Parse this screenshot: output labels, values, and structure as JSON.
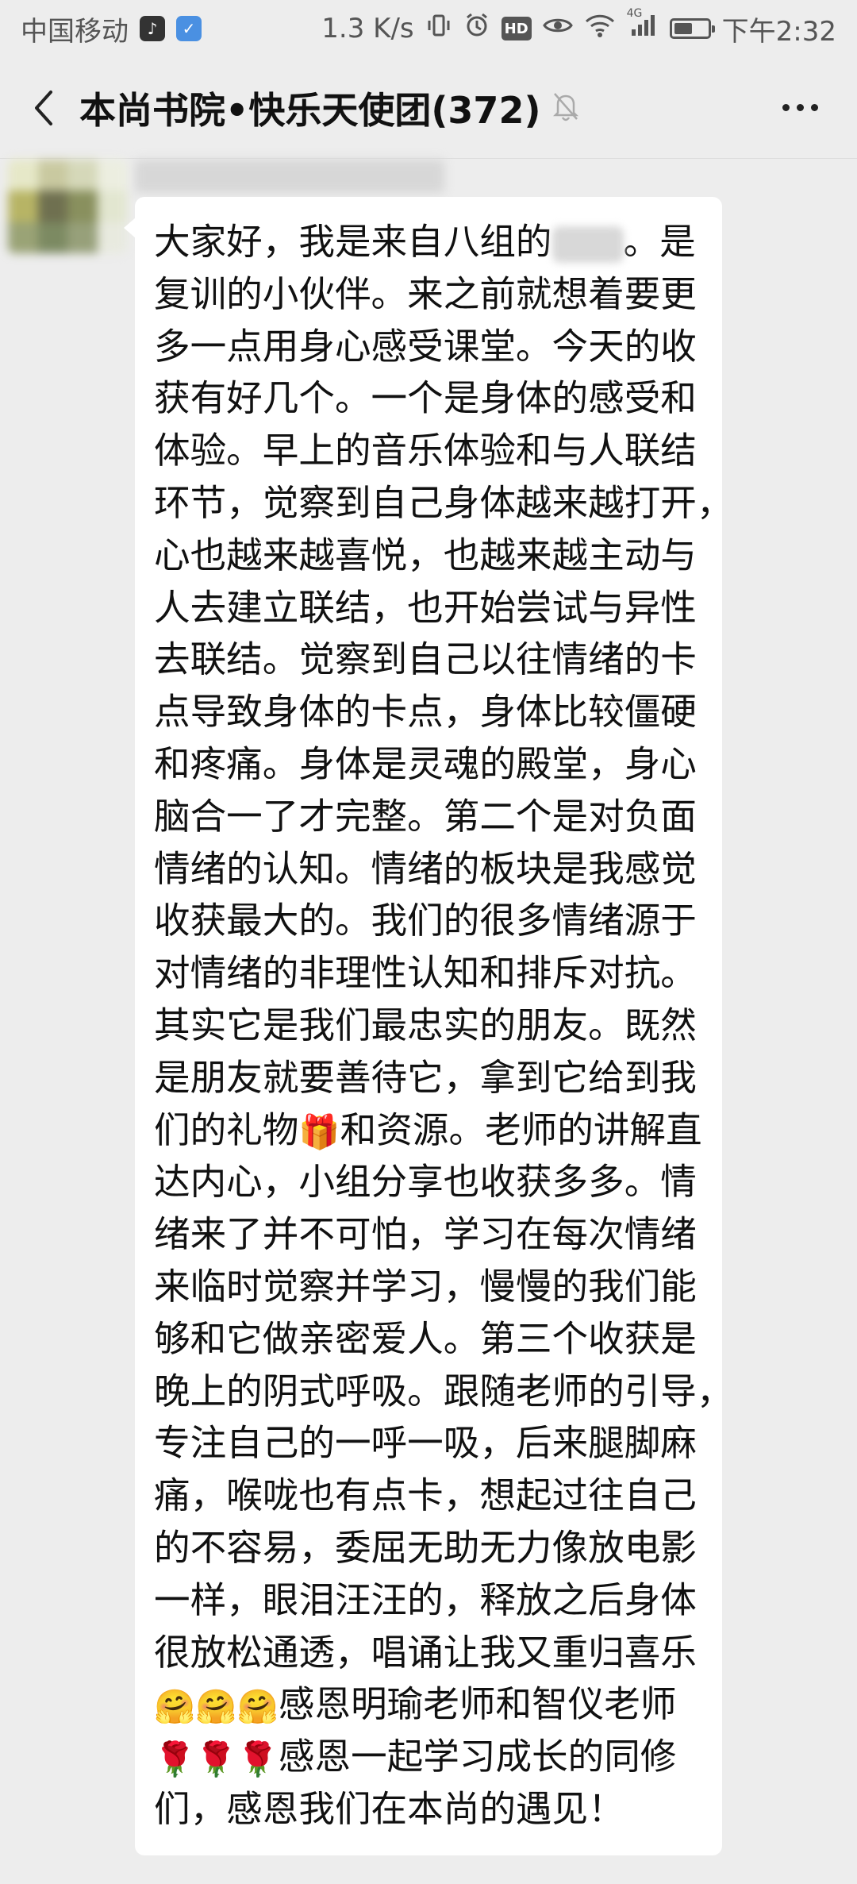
{
  "status_bar": {
    "carrier": "中国移动",
    "speed": "1.3 K/s",
    "network": "4G",
    "battery_level": 0.55,
    "time": "下午2:32",
    "icons": [
      "tiktok-icon",
      "shield-icon",
      "vibrate-icon",
      "alarm-icon",
      "hd-icon",
      "eye-icon",
      "wifi-icon",
      "signal-icon",
      "battery-icon"
    ]
  },
  "header": {
    "title": "本尚书院•快乐天使团(372)",
    "muted_icon": "bell-off-icon",
    "back_icon": "chevron-left-icon",
    "more_icon": "more-dots-icon"
  },
  "message": {
    "sender_redacted": true,
    "lines": [
      [
        "大家好，我是来自八组的",
        "[redacted]",
        "。是"
      ],
      [
        "复训的小伙伴。来之前就想着要更"
      ],
      [
        "多一点用身心感受课堂。今天的收"
      ],
      [
        "获有好几个。一个是身体的感受和"
      ],
      [
        "体验。早上的音乐体验和与人联结"
      ],
      [
        "环节，觉察到自己身体越来越打开，"
      ],
      [
        "心也越来越喜悦，也越来越主动与"
      ],
      [
        "人去建立联结，也开始尝试与异性"
      ],
      [
        "去联结。觉察到自己以往情绪的卡"
      ],
      [
        "点导致身体的卡点，身体比较僵硬"
      ],
      [
        "和疼痛。身体是灵魂的殿堂，身心"
      ],
      [
        "脑合一了才完整。第二个是对负面"
      ],
      [
        "情绪的认知。情绪的板块是我感觉"
      ],
      [
        "收获最大的。我们的很多情绪源于"
      ],
      [
        "对情绪的非理性认知和排斥对抗。"
      ],
      [
        "其实它是我们最忠实的朋友。既然"
      ],
      [
        "是朋友就要善待它，拿到它给到我"
      ],
      [
        "们的礼物",
        "🎁",
        "和资源。老师的讲解直"
      ],
      [
        "达内心，小组分享也收获多多。情"
      ],
      [
        "绪来了并不可怕，学习在每次情绪"
      ],
      [
        "来临时觉察并学习，慢慢的我们能"
      ],
      [
        "够和它做亲密爱人。第三个收获是"
      ],
      [
        "晚上的阴式呼吸。跟随老师的引导，"
      ],
      [
        "专注自己的一呼一吸，后来腿脚麻"
      ],
      [
        "痛，喉咙也有点卡，想起过往自己"
      ],
      [
        "的不容易，委屈无助无力像放电影"
      ],
      [
        "一样，眼泪汪汪的，释放之后身体"
      ],
      [
        "很放松通透，唱诵让我又重归喜乐"
      ],
      [
        "🤗🤗🤗",
        "感恩明瑜老师和智仪老师"
      ],
      [
        "🌹🌹🌹",
        "感恩一起学习成长的同修"
      ],
      [
        "们，感恩我们在本尚的遇见！"
      ]
    ]
  }
}
